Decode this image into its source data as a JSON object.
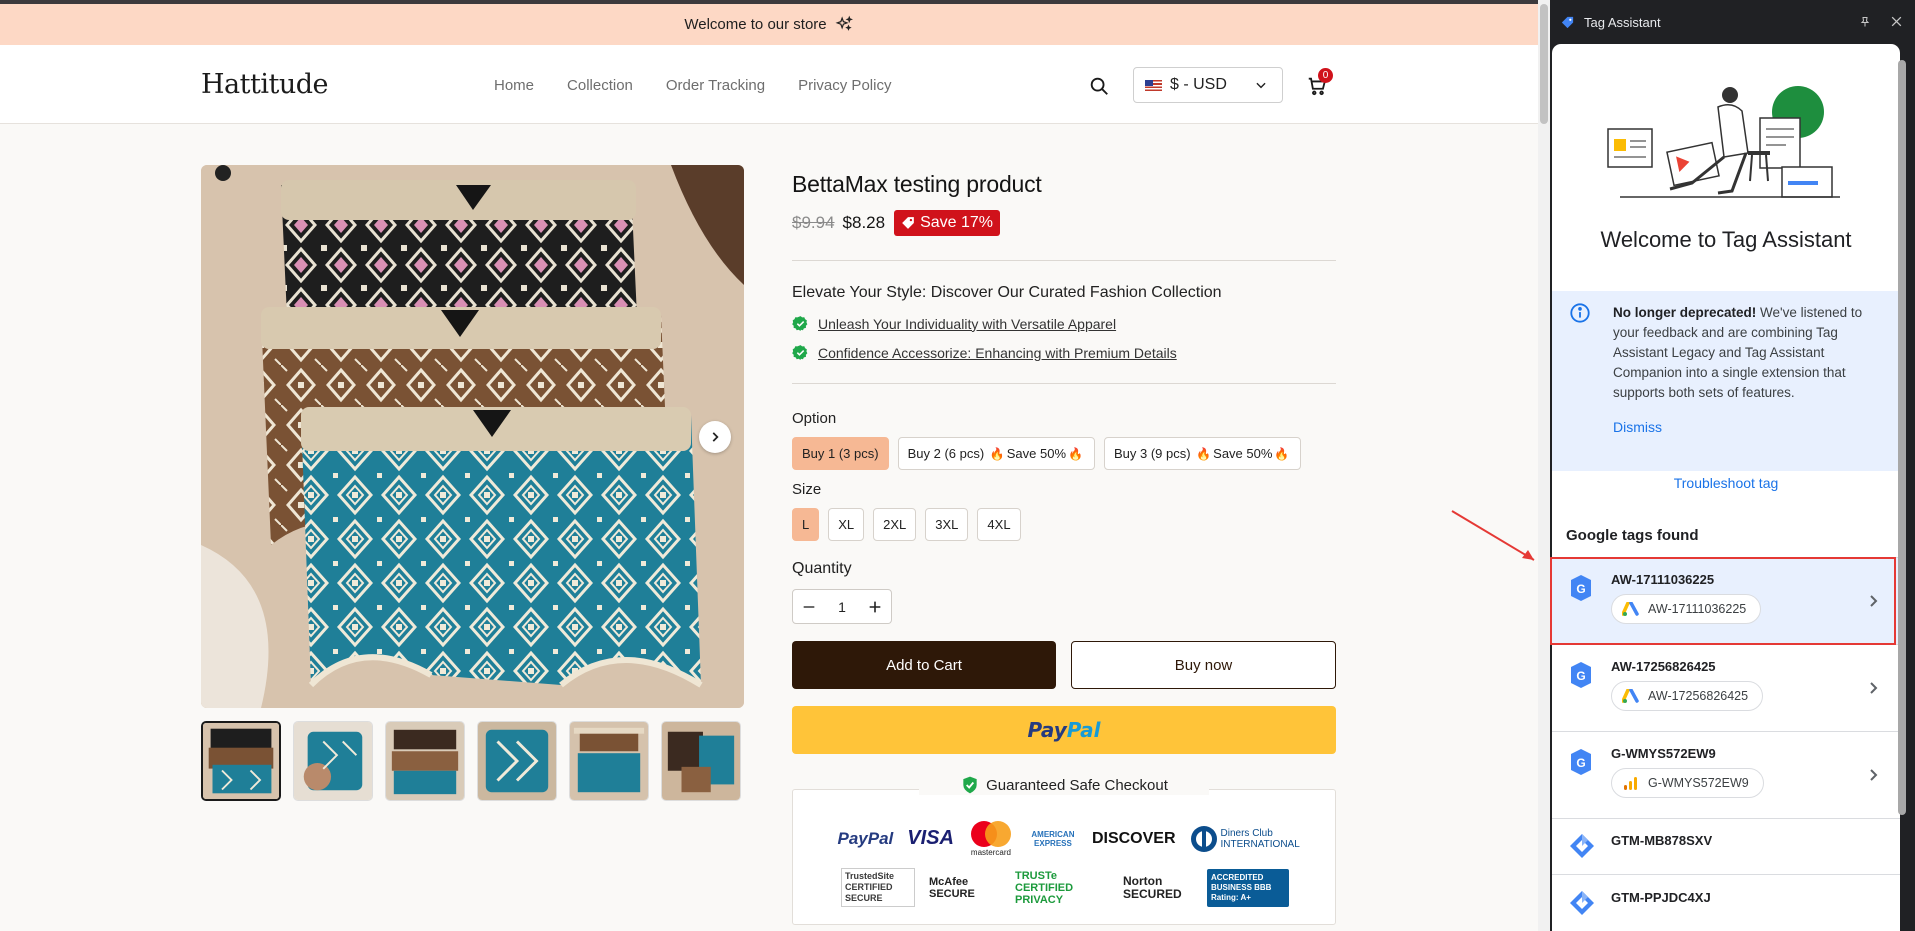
{
  "store": {
    "announcement": "Welcome to our store",
    "brand": "Hattitude",
    "nav": [
      "Home",
      "Collection",
      "Order Tracking",
      "Privacy Policy"
    ],
    "currency": "$ - USD",
    "cart_count": "0"
  },
  "product": {
    "title": "BettaMax testing product",
    "old_price": "$9.94",
    "price": "$8.28",
    "save_badge": "Save 17%",
    "tagline": "Elevate Your Style: Discover Our Curated Fashion Collection",
    "bullets": [
      "Unleash Your Individuality with Versatile Apparel",
      "Confidence Accessorize: Enhancing with Premium Details"
    ],
    "option_label": "Option",
    "options": [
      {
        "main": "Buy 1 (3 pcs)",
        "extra": ""
      },
      {
        "main": "Buy 2 (6 pcs)",
        "extra": "Save 50%"
      },
      {
        "main": "Buy 3 (9 pcs)",
        "extra": "Save 50%"
      }
    ],
    "size_label": "Size",
    "sizes": [
      "L",
      "XL",
      "2XL",
      "3XL",
      "4XL"
    ],
    "quantity_label": "Quantity",
    "quantity": "1",
    "add_to_cart": "Add to Cart",
    "buy_now": "Buy now",
    "paypal_part1": "Pay",
    "paypal_part2": "Pal",
    "safe_checkout": "Guaranteed Safe Checkout",
    "payment_logos": [
      "PayPal",
      "VISA",
      "mastercard",
      "AMERICAN EXPRESS",
      "DISCOVER",
      "Diners Club INTERNATIONAL"
    ],
    "trust_logos": [
      "TrustedSite CERTIFIED SECURE",
      "McAfee SECURE",
      "TRUSTe CERTIFIED PRIVACY",
      "Norton SECURED",
      "ACCREDITED BUSINESS BBB Rating: A+"
    ]
  },
  "tag_assistant": {
    "window_title": "Tag Assistant",
    "welcome": "Welcome to Tag Assistant",
    "notice_bold": "No longer deprecated!",
    "notice_text": " We've listened to your feedback and are combining Tag Assistant Legacy and Tag Assistant Companion into a single extension that supports both sets of features.",
    "dismiss": "Dismiss",
    "troubleshoot": "Troubleshoot tag",
    "found_heading": "Google tags found",
    "tags": [
      {
        "id": "AW-17111036225",
        "chip": "AW-17111036225",
        "kind": "ads",
        "selected": true
      },
      {
        "id": "AW-17256826425",
        "chip": "AW-17256826425",
        "kind": "ads",
        "selected": false
      },
      {
        "id": "G-WMYS572EW9",
        "chip": "G-WMYS572EW9",
        "kind": "analytics",
        "selected": false
      },
      {
        "id": "GTM-MB878SXV",
        "chip": "",
        "kind": "gtm",
        "selected": false
      },
      {
        "id": "GTM-PPJDC4XJ",
        "chip": "",
        "kind": "gtm",
        "selected": false
      }
    ]
  },
  "colors": {
    "announce_bg": "#fdd8c5",
    "sale_red": "#d0121b",
    "cart_brown": "#2e1808",
    "paypal_yellow": "#ffc439",
    "option_selected": "#f6b894",
    "ta_blue": "#1a73e8",
    "highlight_red": "#e53935"
  }
}
